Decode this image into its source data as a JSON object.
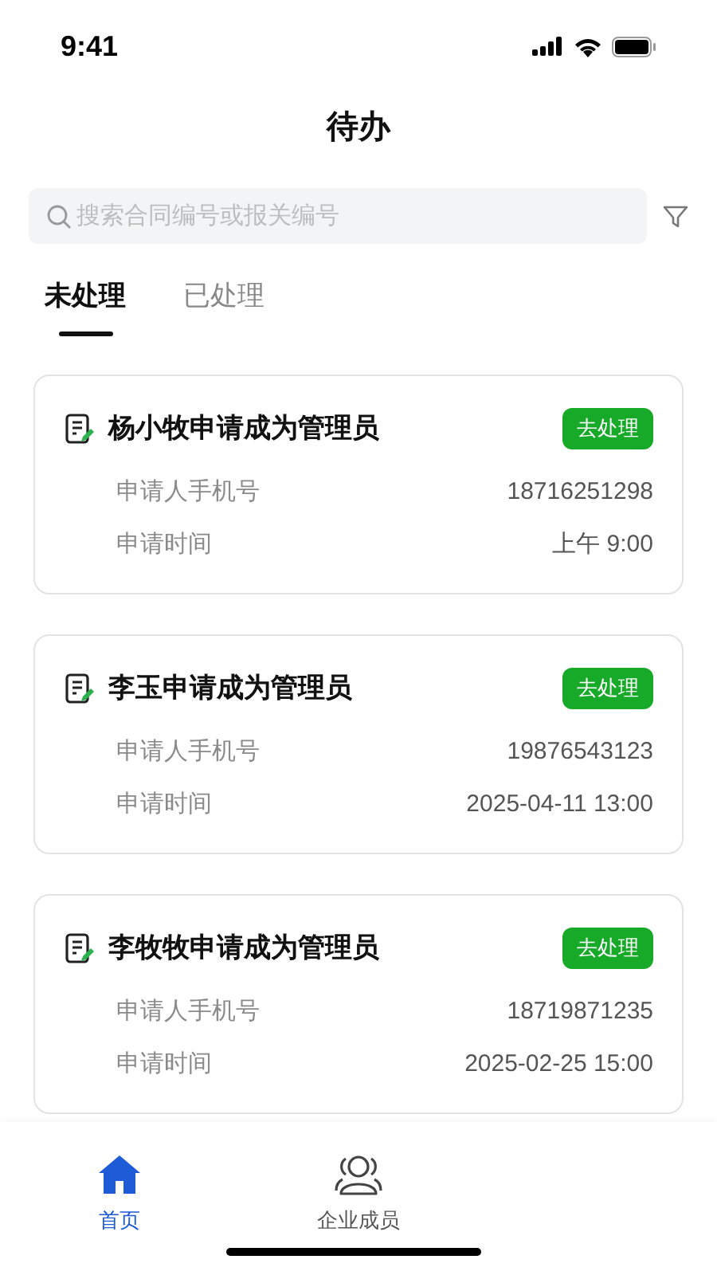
{
  "status_bar": {
    "time": "9:41"
  },
  "title": "待办",
  "search": {
    "placeholder": "搜索合同编号或报关编号"
  },
  "tabs": [
    {
      "label": "未处理",
      "selected": true
    },
    {
      "label": "已处理",
      "selected": false
    }
  ],
  "cards": [
    {
      "title": "杨小牧申请成为管理员",
      "action": "去处理",
      "rows": [
        {
          "label": "申请人手机号",
          "value": "18716251298"
        },
        {
          "label": "申请时间",
          "value": "上午 9:00"
        }
      ]
    },
    {
      "title": "李玉申请成为管理员",
      "action": "去处理",
      "rows": [
        {
          "label": "申请人手机号",
          "value": "19876543123"
        },
        {
          "label": "申请时间",
          "value": "2025-04-11 13:00"
        }
      ]
    },
    {
      "title": "李牧牧申请成为管理员",
      "action": "去处理",
      "rows": [
        {
          "label": "申请人手机号",
          "value": "18719871235"
        },
        {
          "label": "申请时间",
          "value": "2025-02-25 15:00"
        }
      ]
    }
  ],
  "bottom_nav": [
    {
      "label": "首页",
      "kind": "home",
      "selected": true
    },
    {
      "label": "企业成员",
      "kind": "people",
      "selected": false
    }
  ]
}
